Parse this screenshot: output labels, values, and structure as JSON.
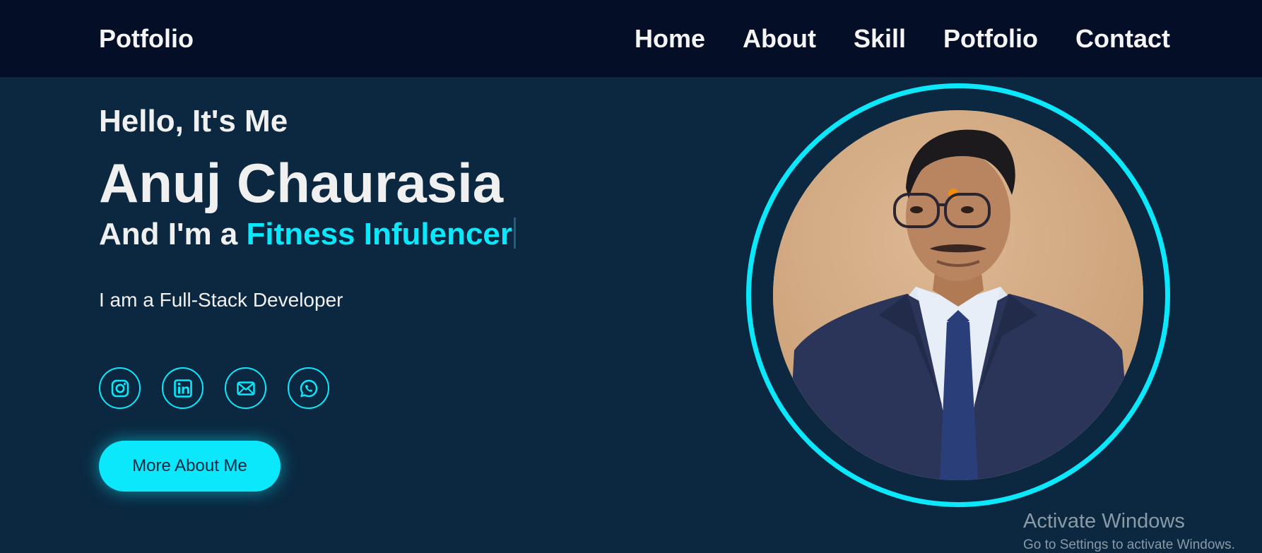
{
  "header": {
    "logo": "Potfolio",
    "nav": [
      "Home",
      "About",
      "Skill",
      "Potfolio",
      "Contact"
    ]
  },
  "hero": {
    "greeting": "Hello, It's Me",
    "name": "Anuj Chaurasia",
    "role_prefix": "And I'm a ",
    "role_highlight": "Fitness Infulencer",
    "tagline": "I am a Full-Stack Developer",
    "cta": "More About Me",
    "socials": [
      "instagram-icon",
      "linkedin-icon",
      "mail-icon",
      "whatsapp-icon"
    ]
  },
  "watermark": {
    "title": "Activate Windows",
    "subtitle": "Go to Settings to activate Windows."
  },
  "colors": {
    "background": "#0b2840",
    "header": "#040e26",
    "accent": "#0be8fb"
  }
}
